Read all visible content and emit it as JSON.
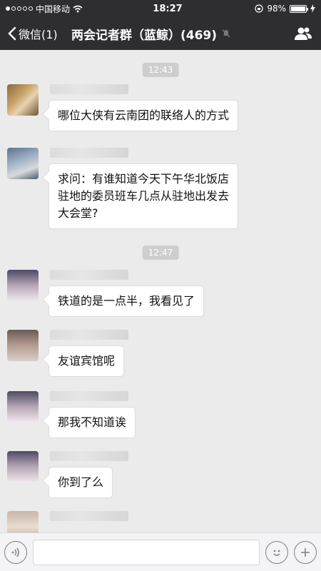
{
  "status_bar": {
    "carrier": "中国移动",
    "time": "18:27",
    "battery": "98%",
    "battery_level": 0.98
  },
  "nav": {
    "back_label": "微信(1)",
    "title": "两会记者群（蓝鲸）(469)"
  },
  "timestamps": [
    "12:43",
    "12:47"
  ],
  "messages": [
    {
      "text": "哪位大侠有云南团的联络人的方式"
    },
    {
      "text": "求问：有谁知道今天下午华北饭店\n驻地的委员班车几点从驻地出发去\n大会堂?"
    },
    {
      "text": "铁道的是一点半，我看见了"
    },
    {
      "text": "友谊宾馆呢"
    },
    {
      "text": "那我不知道诶"
    },
    {
      "text": "你到了么"
    }
  ],
  "colors": {
    "header_bg": "#2d2d32",
    "chat_bg": "#ebebeb",
    "bubble_bg": "#ffffff"
  },
  "icons": [
    "signal-dots-icon",
    "wifi-icon",
    "rotation-lock-icon",
    "battery-icon",
    "charging-icon",
    "back-chevron-icon",
    "mute-icon",
    "group-members-icon",
    "voice-icon",
    "emoji-icon",
    "plus-icon"
  ]
}
